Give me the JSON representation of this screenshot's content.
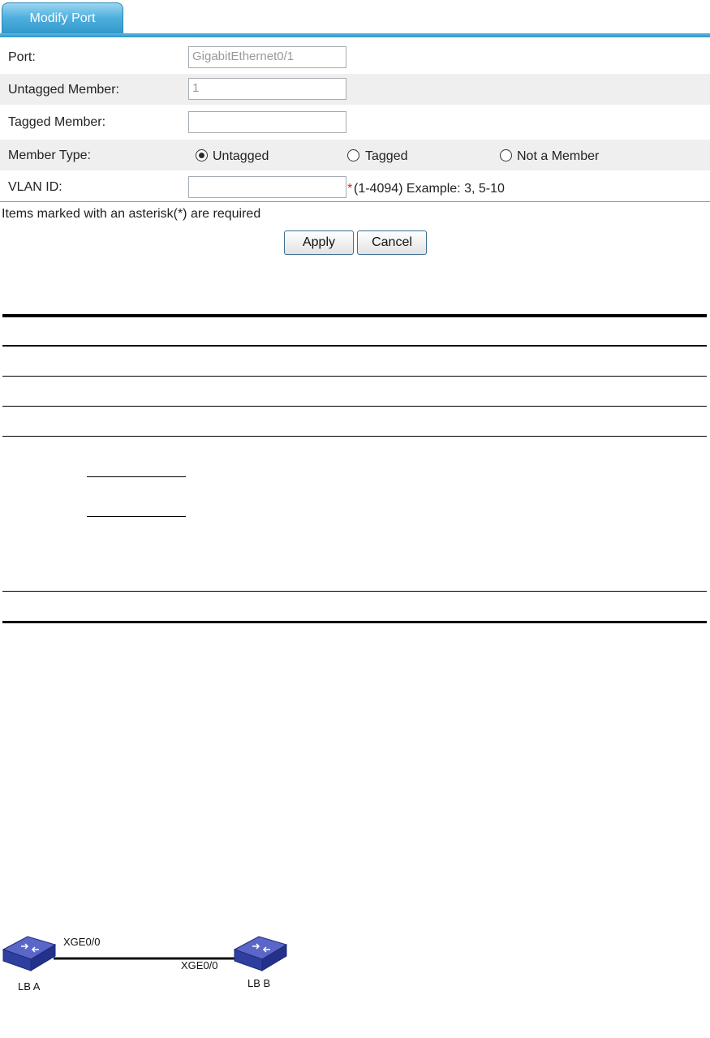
{
  "tab": {
    "label": "Modify Port"
  },
  "form": {
    "port": {
      "label": "Port:",
      "value": "GigabitEthernet0/1"
    },
    "untagged_member": {
      "label": "Untagged Member:",
      "value": "1"
    },
    "tagged_member": {
      "label": "Tagged Member:",
      "value": ""
    },
    "member_type": {
      "label": "Member Type:",
      "options": [
        "Untagged",
        "Tagged",
        "Not a Member"
      ],
      "selected": "Untagged"
    },
    "vlan_id": {
      "label": "VLAN ID:",
      "value": "",
      "required_mark": "*",
      "hint": "(1-4094) Example: 3, 5-10"
    },
    "required_note": "Items marked with an asterisk(*) are required",
    "apply_label": "Apply",
    "cancel_label": "Cancel"
  },
  "diagram": {
    "devices": [
      "LB A",
      "LB B"
    ],
    "ports": [
      "XGE0/0",
      "XGE0/0"
    ],
    "device_color": "#2f3f9f"
  },
  "colors": {
    "accent": "#2f95c8",
    "required": "#e02020"
  }
}
